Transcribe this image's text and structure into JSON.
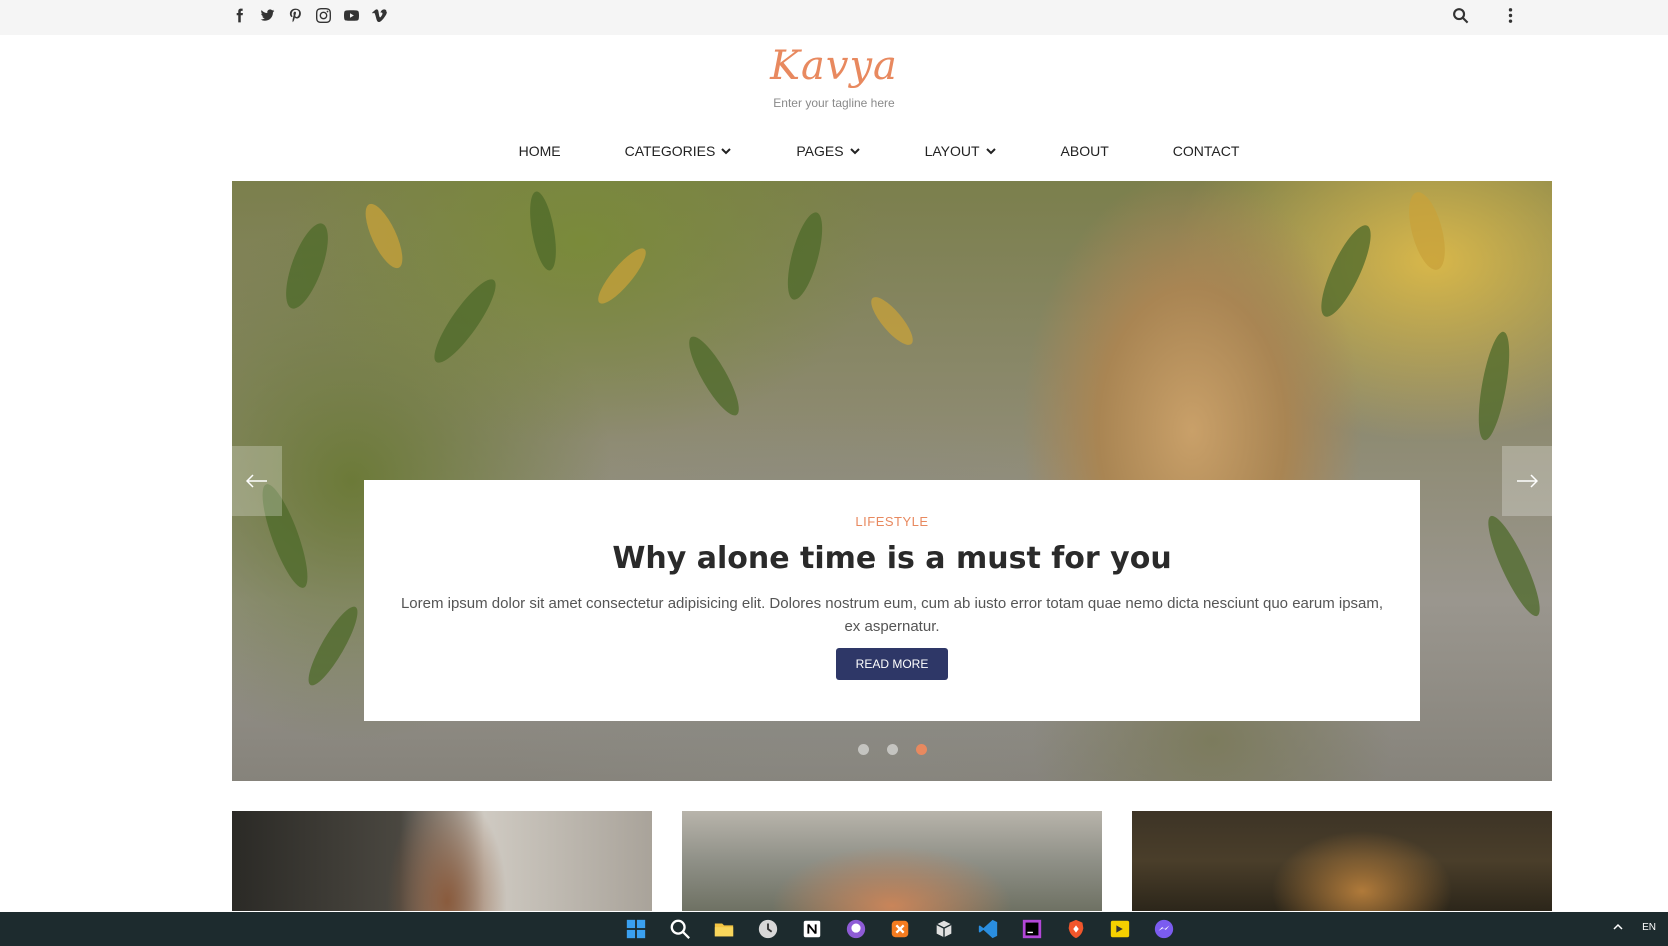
{
  "topbar": {
    "social_icons": [
      "facebook-icon",
      "twitter-icon",
      "pinterest-icon",
      "instagram-icon",
      "youtube-icon",
      "vimeo-icon"
    ],
    "right_icons": [
      "search-icon",
      "more-vertical-icon"
    ]
  },
  "brand": {
    "logo_text": "Kavya",
    "tagline": "Enter your tagline here",
    "accent_color": "#e8895f",
    "button_color": "#2e3767"
  },
  "nav": {
    "items": [
      {
        "label": "HOME",
        "dropdown": false
      },
      {
        "label": "CATEGORIES",
        "dropdown": true
      },
      {
        "label": "PAGES",
        "dropdown": true
      },
      {
        "label": "LAYOUT",
        "dropdown": true
      },
      {
        "label": "ABOUT",
        "dropdown": false
      },
      {
        "label": "CONTACT",
        "dropdown": false
      }
    ]
  },
  "hero": {
    "category": "LIFESTYLE",
    "title": "Why alone time is a must for you",
    "excerpt": "Lorem ipsum dolor sit amet consectetur adipisicing elit. Dolores nostrum eum, cum ab iusto error totam quae nemo dicta nesciunt quo earum ipsam, ex aspernatur.",
    "button_label": "READ MORE",
    "slides_total": 3,
    "active_slide": 3,
    "prev_icon": "arrow-left-icon",
    "next_icon": "arrow-right-icon"
  },
  "taskbar": {
    "apps": [
      "windows-start-icon",
      "search-icon",
      "file-explorer-icon",
      "clock-app-icon",
      "notion-icon",
      "github-icon",
      "xampp-icon",
      "box-app-icon",
      "vscode-icon",
      "phpstorm-icon",
      "brave-icon",
      "player-icon",
      "messenger-icon"
    ],
    "lang": "EN"
  }
}
